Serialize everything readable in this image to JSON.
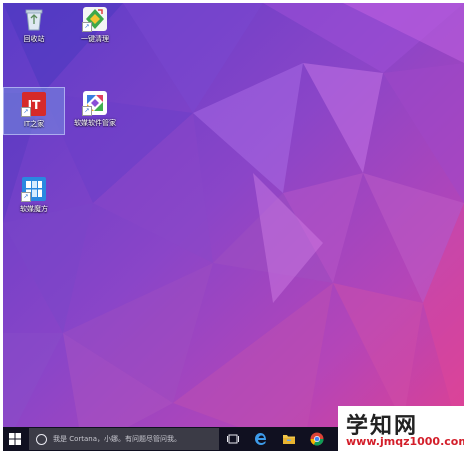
{
  "desktop": {
    "icons": [
      {
        "id": "recycle-bin",
        "label": "回收站",
        "icon": "recycle-bin-icon",
        "selected": false
      },
      {
        "id": "one-click-clean",
        "label": "一键清理",
        "icon": "broom-clean-icon",
        "selected": false
      },
      {
        "id": "ithome",
        "label": "IT之家",
        "icon": "ithome-logo-icon",
        "badge": "IT",
        "selected": true
      },
      {
        "id": "ruanmei-manager",
        "label": "软媒软件管家",
        "icon": "software-manager-icon",
        "selected": false
      },
      {
        "id": "ruanmei-magic",
        "label": "软媒魔方",
        "icon": "magic-cube-icon",
        "selected": false
      }
    ]
  },
  "taskbar": {
    "start_icon": "windows-logo-icon",
    "search_placeholder": "我是 Cortana，小娜。有问题尽管问我。",
    "buttons": [
      {
        "id": "task-view",
        "icon": "task-view-icon"
      },
      {
        "id": "edge",
        "icon": "edge-browser-icon"
      },
      {
        "id": "file-explorer",
        "icon": "folder-icon"
      },
      {
        "id": "chrome",
        "icon": "chrome-icon"
      }
    ]
  },
  "watermark": {
    "title": "学知网",
    "url": "www.jmqz1000.com"
  },
  "colors": {
    "wallpaper_top_left": "#5a3cc8",
    "wallpaper_bottom_right": "#e0408f",
    "taskbar": "#101020",
    "search_box": "#3b3b46",
    "watermark_url": "#d31e2a"
  }
}
